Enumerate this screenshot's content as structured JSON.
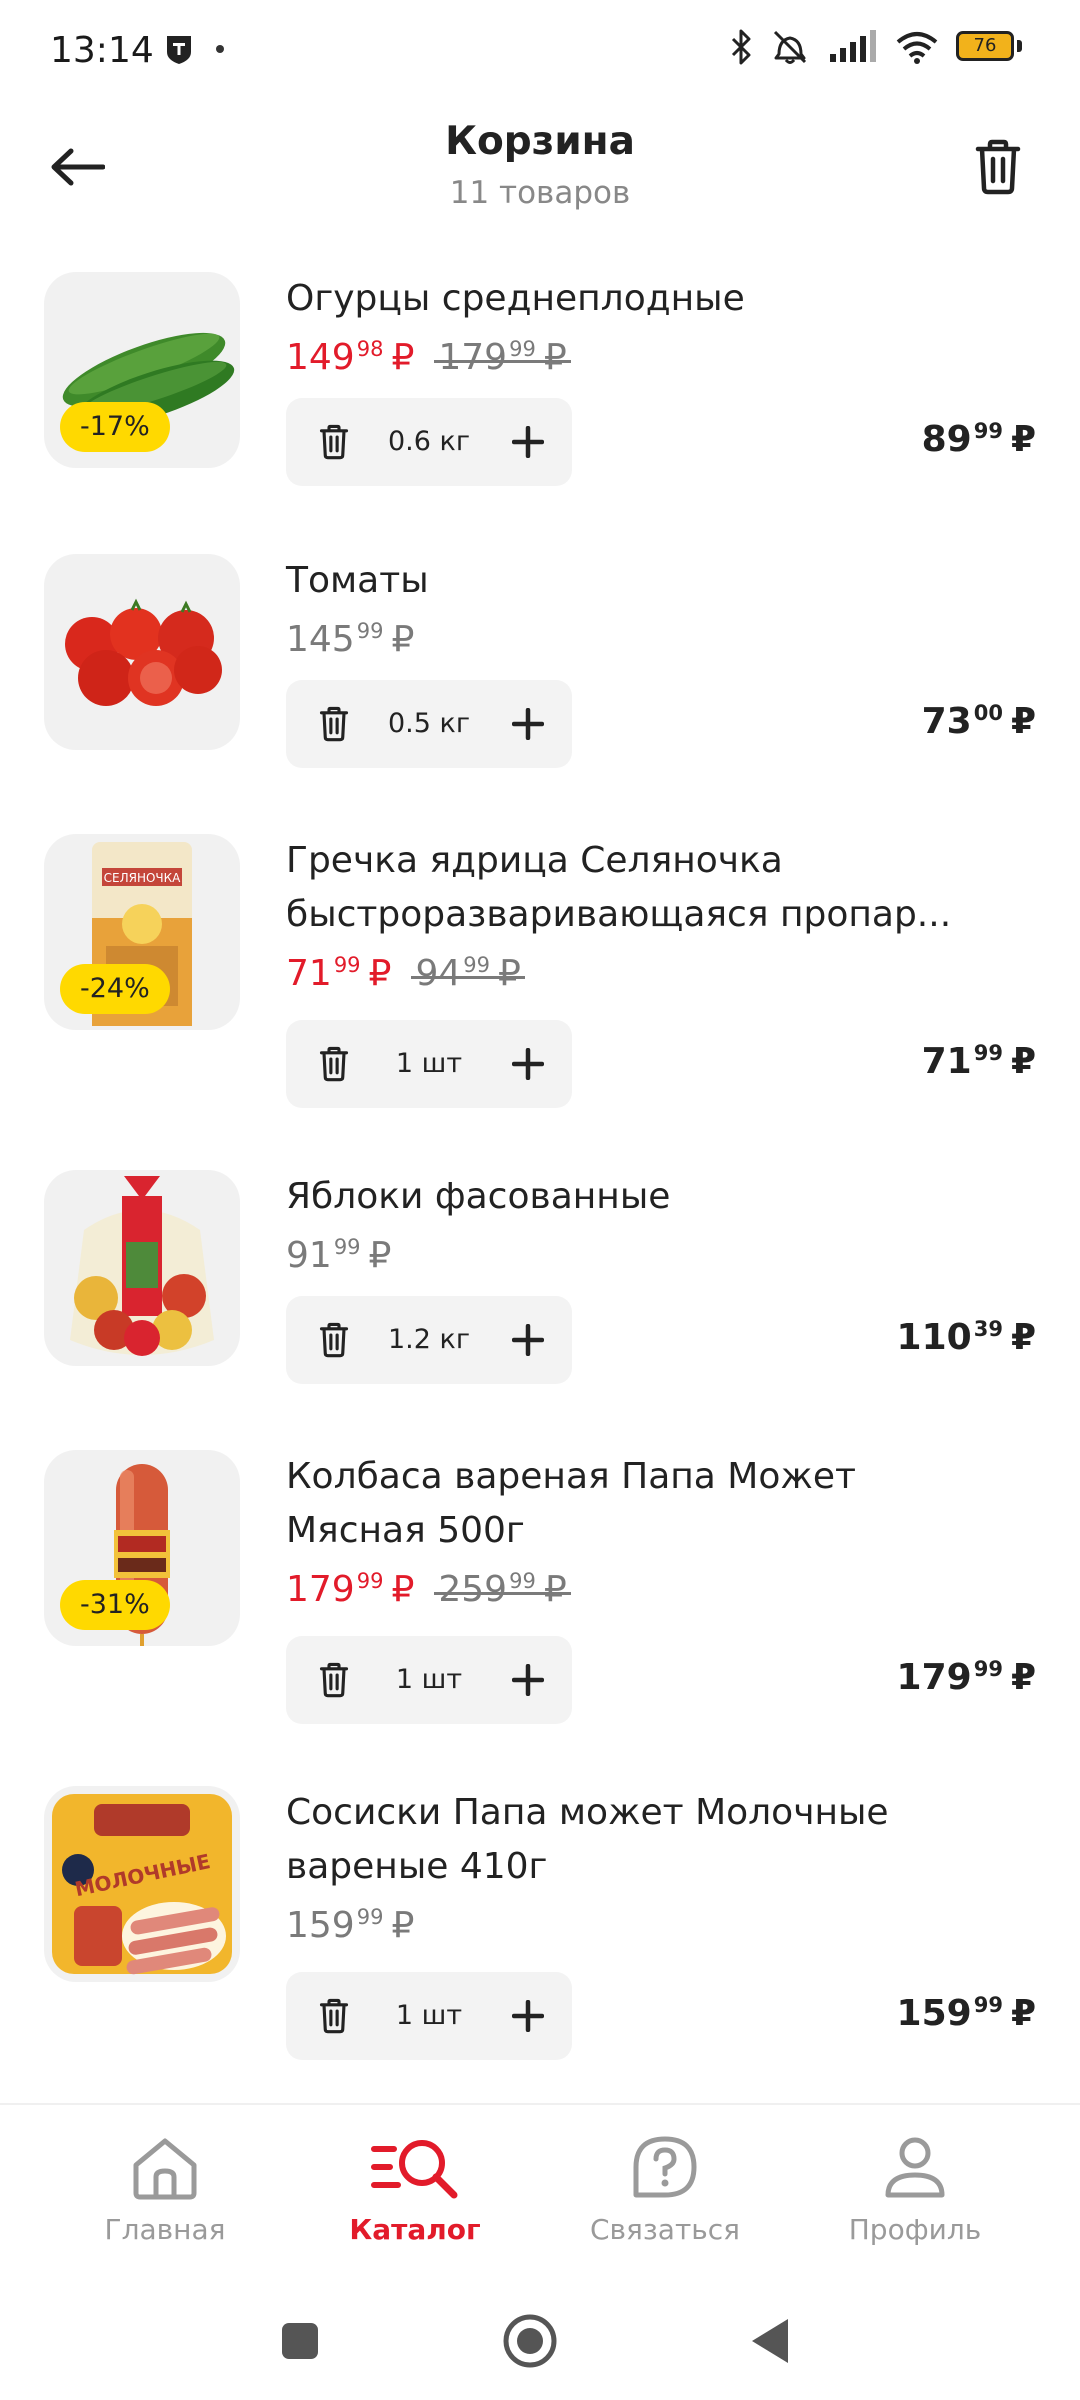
{
  "status_bar": {
    "time": "13:14",
    "battery": "76"
  },
  "header": {
    "title": "Корзина",
    "subtitle": "11 товаров"
  },
  "items": [
    {
      "name": "Огурцы среднеплодные",
      "discount": "-17%",
      "price": {
        "int": "149",
        "dec": "98",
        "cur": "₽",
        "type": "sale"
      },
      "old_price": {
        "int": "179",
        "dec": "99",
        "cur": "₽"
      },
      "quantity": "0.6 кг",
      "total": {
        "int": "89",
        "dec": "99",
        "cur": "₽"
      },
      "image_icon": "cucumber-image"
    },
    {
      "name": "Томаты",
      "price": {
        "int": "145",
        "dec": "99",
        "cur": "₽",
        "type": "regular"
      },
      "quantity": "0.5 кг",
      "total": {
        "int": "73",
        "dec": "00",
        "cur": "₽"
      },
      "image_icon": "tomatoes-image"
    },
    {
      "name_lines": [
        "Гречка ядрица Селяночка",
        "быстроразваривающаяся пропар..."
      ],
      "discount": "-24%",
      "price": {
        "int": "71",
        "dec": "99",
        "cur": "₽",
        "type": "sale"
      },
      "old_price": {
        "int": "94",
        "dec": "99",
        "cur": "₽"
      },
      "quantity": "1 шт",
      "total": {
        "int": "71",
        "dec": "99",
        "cur": "₽"
      },
      "image_icon": "buckwheat-package-image",
      "package_text": "СЕЛЯНОЧКА"
    },
    {
      "name": "Яблоки фасованные",
      "price": {
        "int": "91",
        "dec": "99",
        "cur": "₽",
        "type": "regular"
      },
      "quantity": "1.2 кг",
      "total": {
        "int": "110",
        "dec": "39",
        "cur": "₽"
      },
      "image_icon": "apples-bag-image"
    },
    {
      "name_lines": [
        "Колбаса вареная Папа Может",
        "Мясная 500г"
      ],
      "discount": "-31%",
      "price": {
        "int": "179",
        "dec": "99",
        "cur": "₽",
        "type": "sale"
      },
      "old_price": {
        "int": "259",
        "dec": "99",
        "cur": "₽"
      },
      "quantity": "1 шт",
      "total": {
        "int": "179",
        "dec": "99",
        "cur": "₽"
      },
      "image_icon": "sausage-image"
    },
    {
      "name_lines": [
        "Сосиски Папа может Молочные",
        "вареные 410г"
      ],
      "price": {
        "int": "159",
        "dec": "99",
        "cur": "₽",
        "type": "regular"
      },
      "quantity": "1 шт",
      "total": {
        "int": "159",
        "dec": "99",
        "cur": "₽"
      },
      "image_icon": "frankfurters-package-image",
      "package_text": "МОЛОЧНЫЕ"
    }
  ],
  "bottom_nav": [
    {
      "label": "Главная",
      "icon": "home-icon",
      "active": false
    },
    {
      "label": "Каталог",
      "icon": "catalog-search-icon",
      "active": true
    },
    {
      "label": "Связаться",
      "icon": "help-chat-icon",
      "active": false
    },
    {
      "label": "Профиль",
      "icon": "profile-icon",
      "active": false
    }
  ],
  "colors": {
    "accent_red": "#e21b2a",
    "badge_yellow": "#ffd900",
    "muted_gray": "#7a7a7a",
    "control_bg": "#f3f3f3"
  }
}
